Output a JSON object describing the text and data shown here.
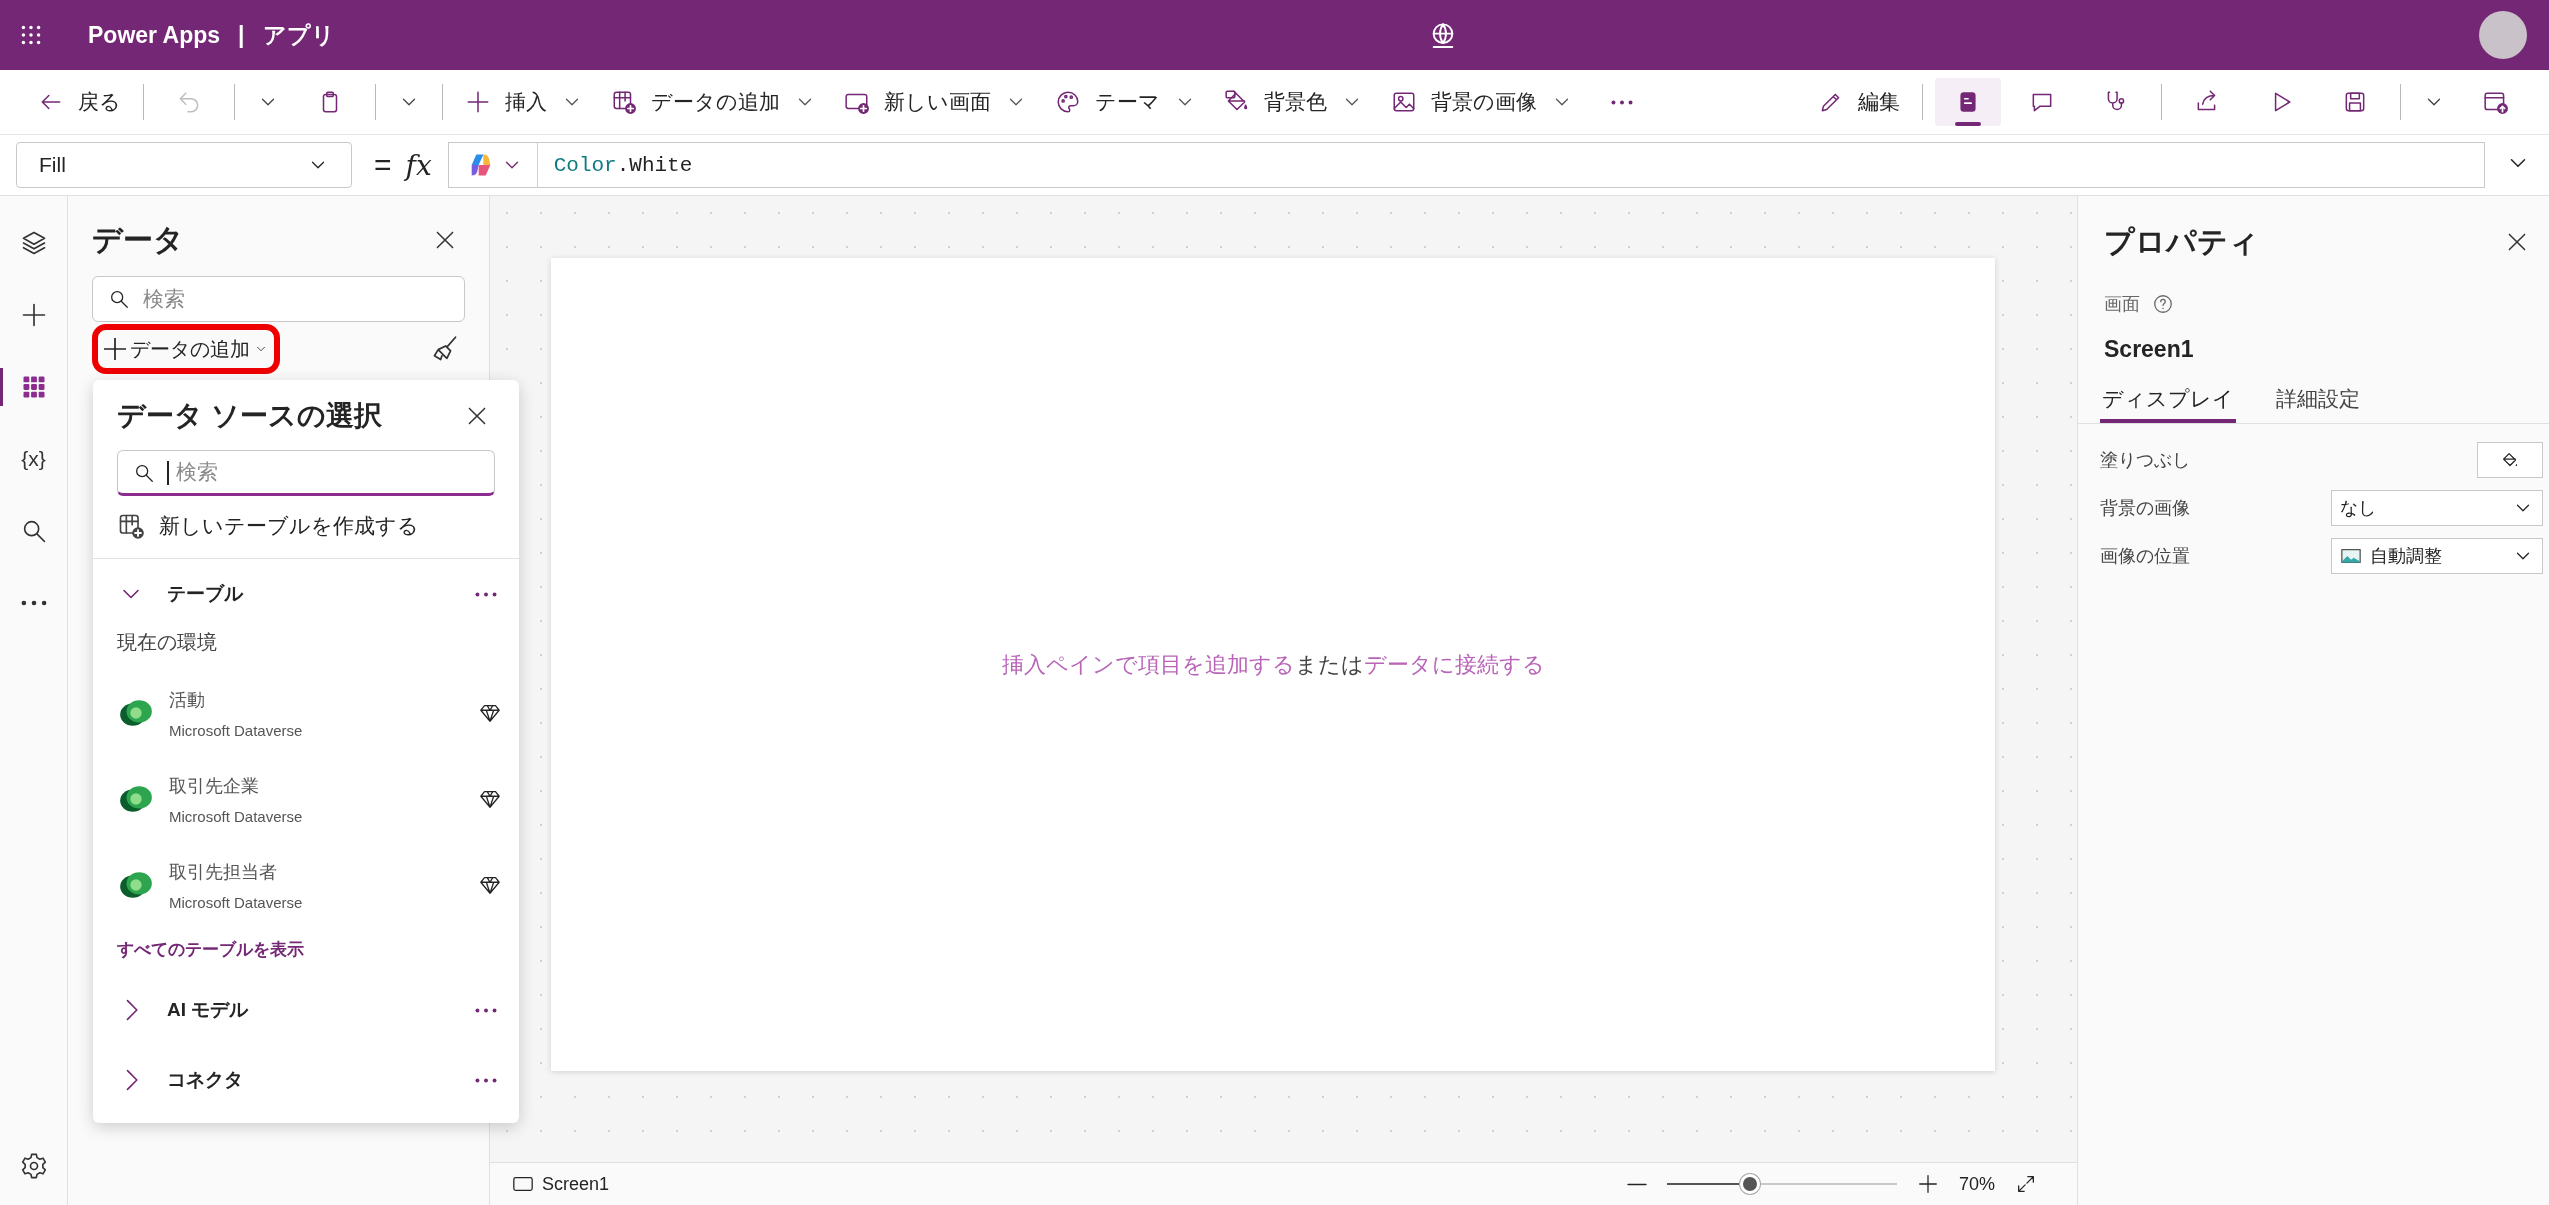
{
  "app_bar": {
    "title": "Power Apps",
    "separator": "|",
    "subtitle": "アプリ"
  },
  "toolbar": {
    "left": [
      {
        "kind": "labeled",
        "label": "戻る",
        "dropdown": false
      },
      {
        "kind": "separator"
      },
      {
        "kind": "icon",
        "disabled": true
      },
      {
        "kind": "separator"
      },
      {
        "kind": "caret"
      },
      {
        "kind": "icon"
      },
      {
        "kind": "separator"
      },
      {
        "kind": "caret"
      },
      {
        "kind": "separator"
      },
      {
        "kind": "labeled",
        "label": "挿入",
        "dropdown": true
      },
      {
        "kind": "labeled",
        "label": "データの追加",
        "dropdown": true
      },
      {
        "kind": "labeled",
        "label": "新しい画面",
        "dropdown": true
      },
      {
        "kind": "labeled",
        "label": "テーマ",
        "dropdown": true
      },
      {
        "kind": "labeled",
        "label": "背景色",
        "dropdown": true
      },
      {
        "kind": "labeled",
        "label": "背景の画像",
        "dropdown": true
      },
      {
        "kind": "icon"
      }
    ],
    "right": [
      {
        "kind": "labeled",
        "label": "編集"
      },
      {
        "kind": "separator"
      },
      {
        "kind": "icon",
        "selected": true
      },
      {
        "kind": "icon",
        "selected": false
      },
      {
        "kind": "icon",
        "selected": false
      },
      {
        "kind": "separator"
      },
      {
        "kind": "icon",
        "selected": false
      },
      {
        "kind": "icon",
        "selected": false
      },
      {
        "kind": "icon",
        "selected": false
      },
      {
        "kind": "separator"
      },
      {
        "kind": "caret"
      },
      {
        "kind": "icon",
        "selected": false
      }
    ]
  },
  "formula_bar": {
    "property": "Fill",
    "equals": "=",
    "fx": "fx",
    "formula_tokens": [
      {
        "kind": "object",
        "text": "Color"
      },
      {
        "kind": "member",
        "text": ".White"
      }
    ]
  },
  "rail": {
    "items": [
      {
        "selected": false
      },
      {
        "selected": false
      },
      {
        "selected": true
      },
      {
        "label": "{x}",
        "selected": false
      },
      {
        "selected": false
      },
      {
        "selected": false
      }
    ]
  },
  "data_panel": {
    "title": "データ",
    "search": {
      "placeholder": "検索"
    },
    "add_button": {
      "label": "データの追加",
      "highlighted": true
    }
  },
  "data_source_popup": {
    "title": "データ ソースの選択",
    "search": {
      "placeholder": "検索",
      "focused": true
    },
    "create_table": "新しいテーブルを作成する",
    "sections": [
      {
        "label": "テーブル",
        "expanded": true,
        "group_label": "現在の環境",
        "items": [
          {
            "name": "活動",
            "source": "Microsoft Dataverse"
          },
          {
            "name": "取引先企業",
            "source": "Microsoft Dataverse"
          },
          {
            "name": "取引先担当者",
            "source": "Microsoft Dataverse"
          }
        ],
        "link": "すべてのテーブルを表示"
      },
      {
        "label": "AI モデル",
        "expanded": false
      },
      {
        "label": "コネクタ",
        "expanded": false
      }
    ]
  },
  "canvas": {
    "hint": [
      {
        "kind": "link",
        "text": "挿入ペインで項目を追加する"
      },
      {
        "kind": "text",
        "text": "または"
      },
      {
        "kind": "link",
        "text": "データに接続する"
      }
    ]
  },
  "properties_panel": {
    "title": "プロパティ",
    "type_label": "画面",
    "name": "Screen1",
    "tabs": [
      {
        "label": "ディスプレイ",
        "selected": true
      },
      {
        "label": "詳細設定",
        "selected": false
      }
    ],
    "rows": [
      {
        "kind": "color",
        "label": "塗りつぶし"
      },
      {
        "kind": "dropdown",
        "label": "背景の画像",
        "value": "なし"
      },
      {
        "kind": "image-dropdown",
        "label": "画像の位置",
        "value": "自動調整"
      }
    ]
  },
  "status_bar": {
    "screen": "Screen1",
    "zoom": {
      "level": 0.36,
      "reading": "70%"
    }
  }
}
